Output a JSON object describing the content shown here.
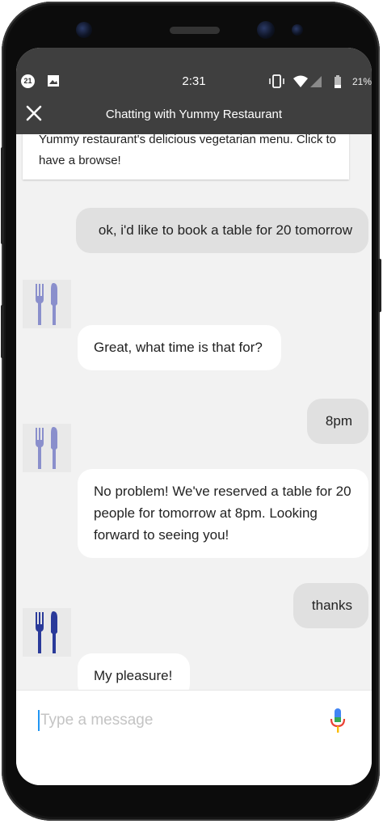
{
  "status_bar": {
    "notification_count": "21",
    "time": "2:31",
    "battery": "21%"
  },
  "header": {
    "title": "Chatting with Yummy Restaurant"
  },
  "card": {
    "text": "Yummy restaurant's delicious vegetarian menu. Click to have a browse!"
  },
  "messages": [
    {
      "from": "user",
      "text": "ok, i'd like to book a table for 20 tomorrow"
    },
    {
      "from": "bot",
      "text": "Great, what time is that for?"
    },
    {
      "from": "user",
      "text": "8pm"
    },
    {
      "from": "bot",
      "text": "No problem! We've reserved a table for 20 people for tomorrow at 8pm. Looking forward to seeing you!"
    },
    {
      "from": "user",
      "text": "thanks"
    },
    {
      "from": "bot",
      "text": "My pleasure!"
    }
  ],
  "input": {
    "placeholder": "Type a message",
    "value": ""
  },
  "colors": {
    "header": "#3f3f3f",
    "background": "#f2f2f2",
    "user_bubble": "#e0e0e0",
    "bot_bubble": "#ffffff",
    "cutlery_light": "#8a8fcc",
    "cutlery_dark": "#2a3a9a",
    "cursor": "#2196f3"
  },
  "icons": {
    "close": "close-icon",
    "bot_avatar": "cutlery-icon",
    "mic": "microphone-icon"
  }
}
